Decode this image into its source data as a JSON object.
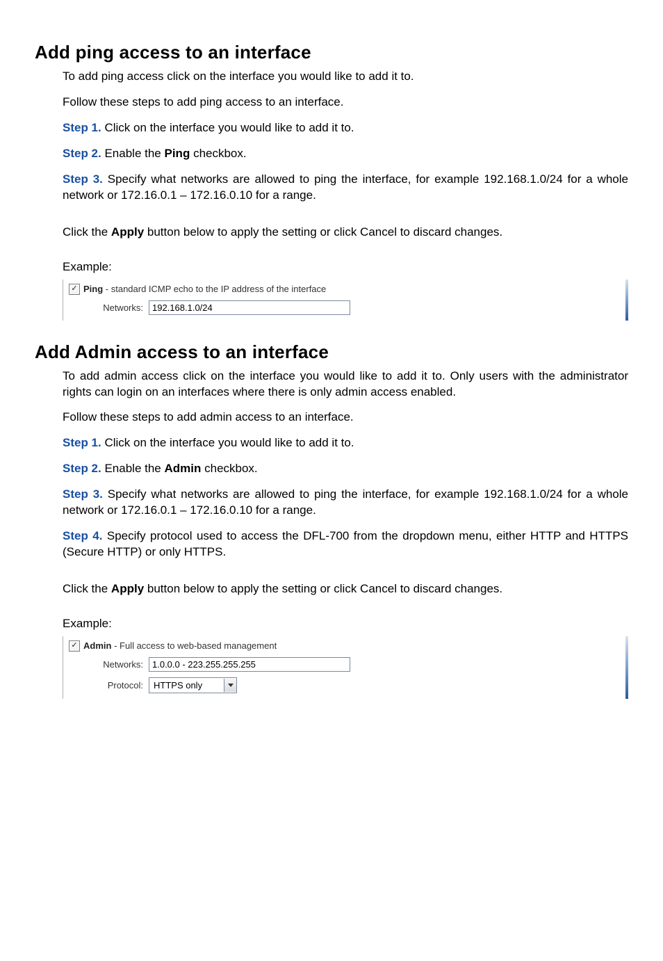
{
  "section1": {
    "title": "Add ping access to an interface",
    "intro": "To add ping access click on the interface you would like to add it to.",
    "follow": "Follow these steps to add ping access to an interface.",
    "step1_bold": "Step 1.",
    "step1_text": " Click on the interface you would like to add it to.",
    "step2_bold": "Step 2.",
    "step2_mid": " Enable the ",
    "step2_check": "Ping",
    "step2_end": " checkbox.",
    "step3_bold": "Step 3.",
    "step3_text": " Specify what networks are allowed to ping the interface, for example 192.168.1.0/24 for a whole network or 172.16.0.1 – 172.16.0.10 for a range.",
    "apply_pre": "Click the ",
    "apply_bold": "Apply",
    "apply_post": " button below to apply the setting or click Cancel to discard changes.",
    "example_label": "Example:",
    "ping_check_label": "Ping",
    "ping_check_desc": " - standard ICMP echo to the IP address of the interface",
    "networks_label": "Networks:",
    "networks_value": "192.168.1.0/24"
  },
  "section2": {
    "title": "Add Admin access to an interface",
    "intro": "To add admin access click on the interface you would like to add it to. Only users with the administrator rights can login on an interfaces where there is only admin access enabled.",
    "follow": "Follow these steps to add admin access to an interface.",
    "step1_bold": "Step 1.",
    "step1_text": " Click on the interface you would like to add it to.",
    "step2_bold": "Step 2.",
    "step2_mid": " Enable the ",
    "step2_check": "Admin",
    "step2_end": " checkbox.",
    "step3_bold": "Step 3.",
    "step3_text": " Specify what networks are allowed to ping the interface, for example 192.168.1.0/24 for a whole network or 172.16.0.1 – 172.16.0.10 for a range.",
    "step4_bold": "Step 4.",
    "step4_text": " Specify protocol used to access the DFL-700 from the dropdown menu, either HTTP and HTTPS (Secure HTTP) or only HTTPS.",
    "apply_pre": "Click the ",
    "apply_bold": "Apply",
    "apply_post": " button below to apply the setting or click Cancel to discard changes.",
    "example_label": "Example:",
    "admin_check_label": "Admin",
    "admin_check_desc": " - Full access to web-based management",
    "networks_label": "Networks:",
    "networks_value": "1.0.0.0 - 223.255.255.255",
    "protocol_label": "Protocol:",
    "protocol_value": "HTTPS only"
  }
}
